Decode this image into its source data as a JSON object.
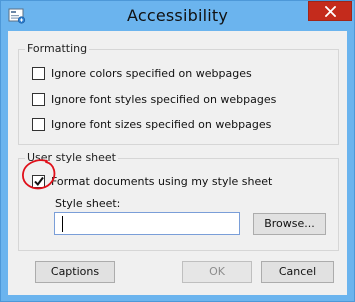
{
  "window": {
    "title": "Accessibility",
    "icon": "accessibility-options-icon",
    "close_icon": "close-icon"
  },
  "formatting": {
    "group_label": "Formatting",
    "options": [
      {
        "label": "Ignore colors specified on webpages",
        "checked": false
      },
      {
        "label": "Ignore font styles specified on webpages",
        "checked": false
      },
      {
        "label": "Ignore font sizes specified on webpages",
        "checked": false
      }
    ]
  },
  "user_style_sheet": {
    "group_label": "User style sheet",
    "format_option": {
      "label": "Format documents using my style sheet",
      "checked": true
    },
    "style_sheet_label": "Style sheet:",
    "style_sheet_value": "",
    "browse_label": "Browse..."
  },
  "buttons": {
    "captions": "Captions",
    "ok": "OK",
    "ok_enabled": false,
    "cancel": "Cancel"
  },
  "colors": {
    "titlebar": "#6bb4ee",
    "close_button": "#c42b1c",
    "annotation": "#e0101a"
  }
}
